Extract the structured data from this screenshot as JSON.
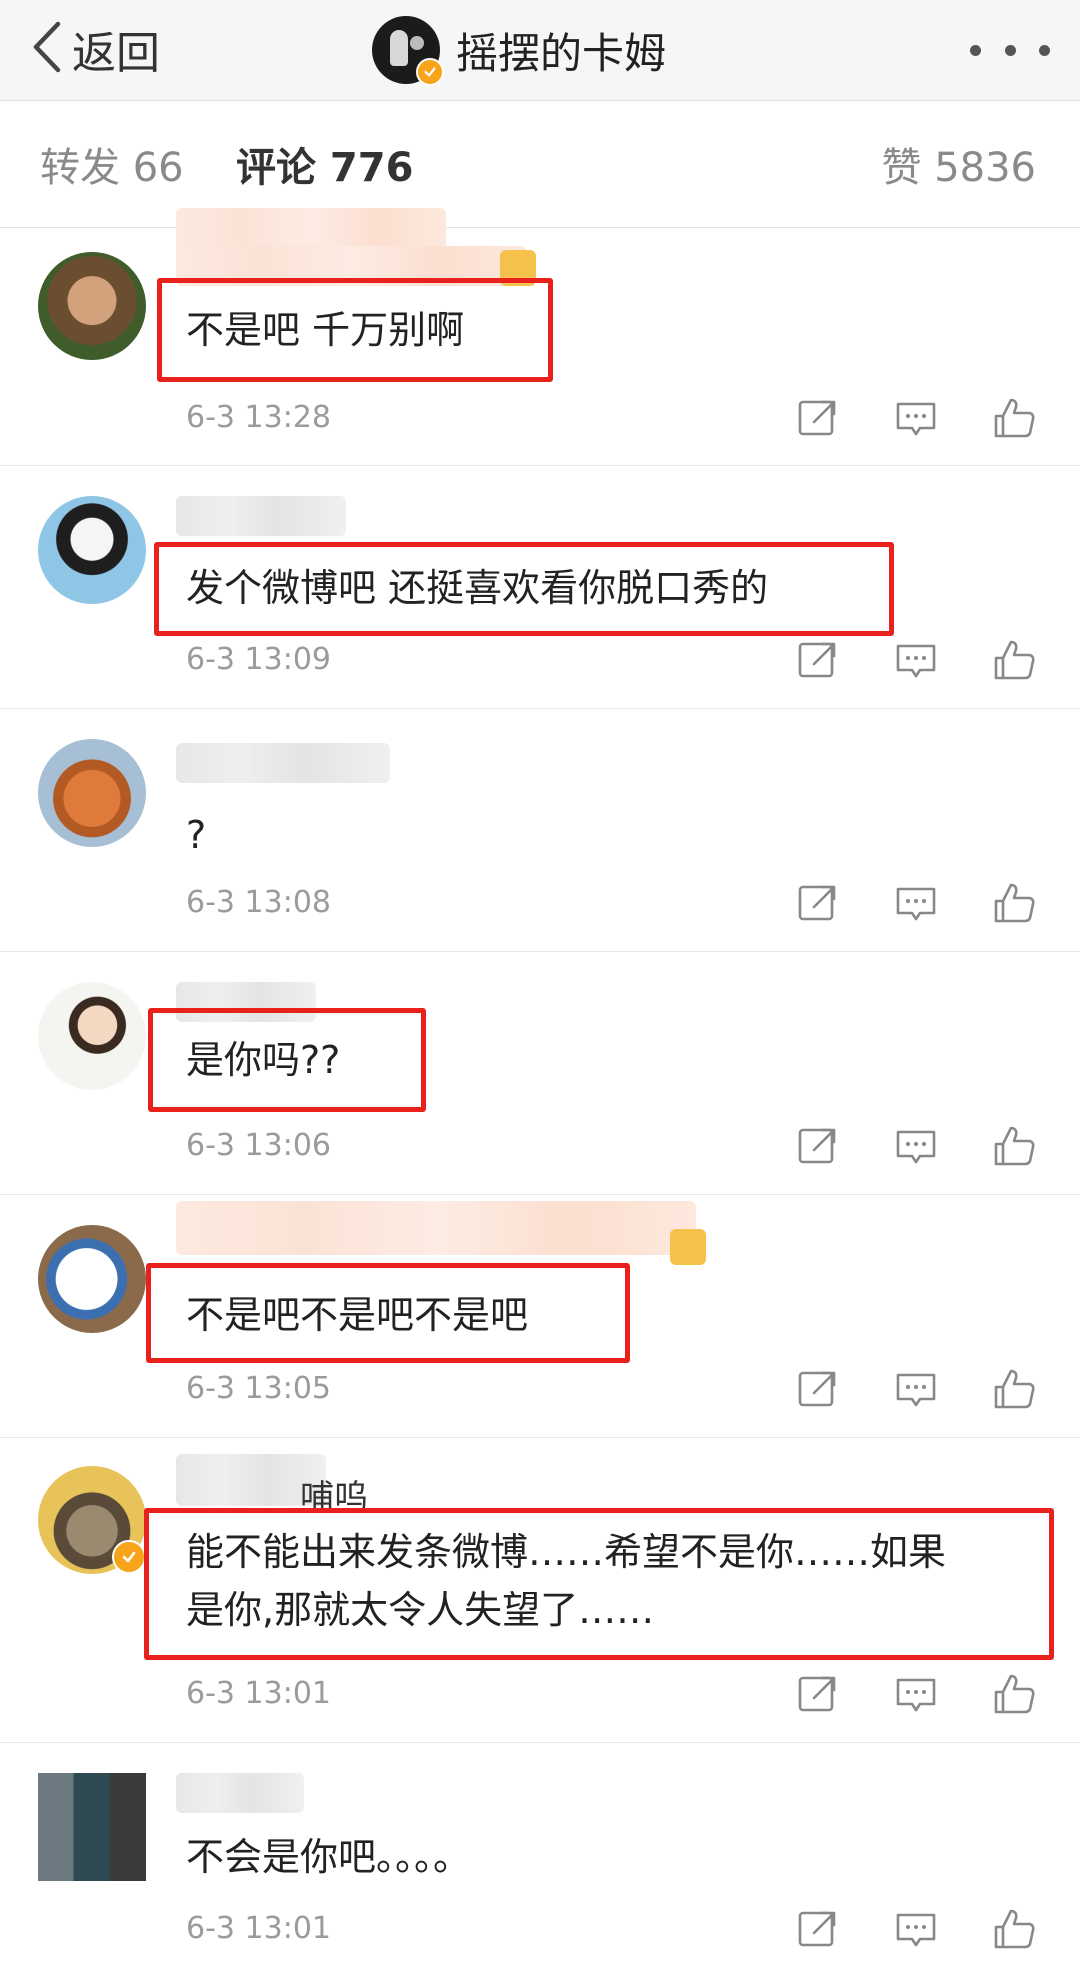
{
  "nav": {
    "back_label": "返回",
    "title": "摇摆的卡姆",
    "more_label": "···"
  },
  "tabs": {
    "repost": "转发 66",
    "comment": "评论 776",
    "like": "赞 5836"
  },
  "comments": [
    {
      "text": "不是吧 千万别啊",
      "time": "6-3 13:28",
      "highlighted": true
    },
    {
      "text": "发个微博吧 还挺喜欢看你脱口秀的",
      "time": "6-3 13:09",
      "highlighted": true
    },
    {
      "text": "?",
      "time": "6-3 13:08",
      "highlighted": false
    },
    {
      "text": "是你吗??",
      "time": "6-3 13:06",
      "highlighted": true
    },
    {
      "text": "不是吧不是吧不是吧",
      "time": "6-3 13:05",
      "highlighted": true
    },
    {
      "username_partial": "哺呜",
      "text_line1": "能不能出来发条微博……希望不是你……如果",
      "text_line2": "是你,那就太令人失望了……",
      "time": "6-3 13:01",
      "highlighted": true
    },
    {
      "text": "不会是你吧。。。。",
      "time": "6-3 13:01",
      "highlighted": false
    }
  ],
  "icons": [
    "back-chevron-icon",
    "verified-badge-icon",
    "more-icon",
    "repost-icon",
    "comment-icon",
    "like-icon"
  ],
  "colors": {
    "highlight_box": "#e8211c",
    "verify_badge": "#f7a41a",
    "time_text": "#9b9b9b"
  }
}
